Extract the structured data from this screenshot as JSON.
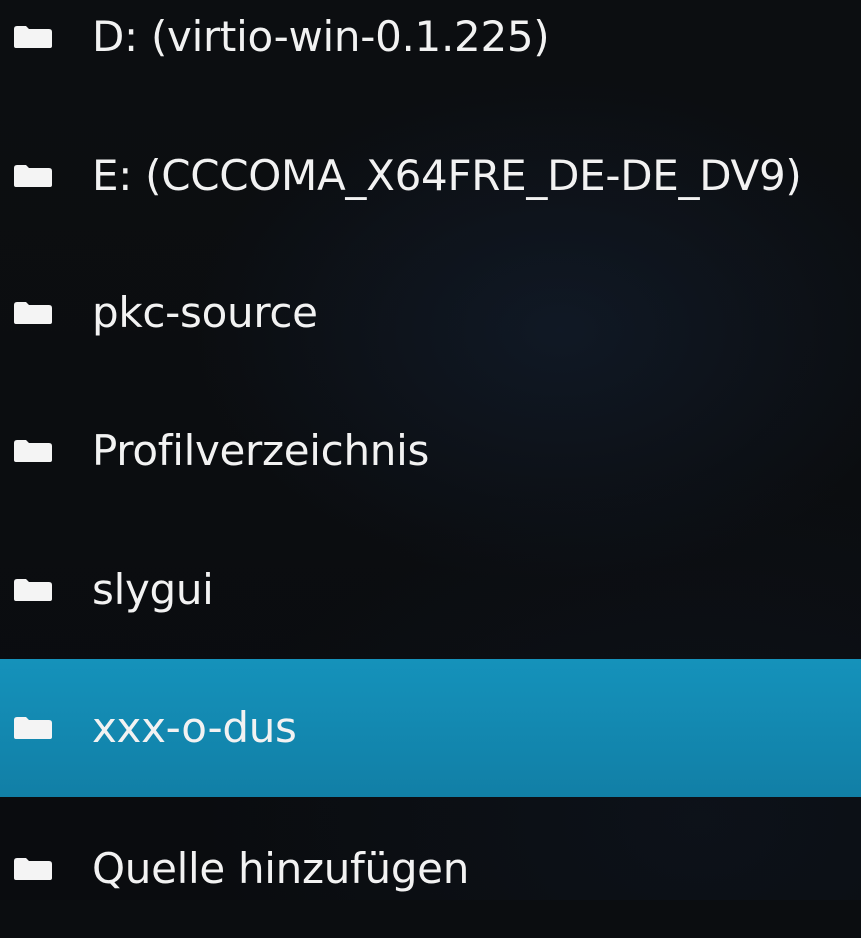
{
  "list": {
    "items": [
      {
        "label": "D: (virtio-win-0.1.225)",
        "icon": "folder-icon"
      },
      {
        "label": "E: (CCCOMA_X64FRE_DE-DE_DV9)",
        "icon": "folder-icon"
      },
      {
        "label": "pkc-source",
        "icon": "folder-icon"
      },
      {
        "label": "Profilverzeichnis",
        "icon": "folder-icon"
      },
      {
        "label": "slygui",
        "icon": "folder-icon"
      },
      {
        "label": "xxx-o-dus",
        "icon": "folder-icon",
        "selected": true
      },
      {
        "label": "Quelle hinzufügen",
        "icon": "folder-icon"
      }
    ]
  },
  "colors": {
    "background": "#0b0d10",
    "selected": "#117fa6",
    "text": "#f2f2f2"
  }
}
